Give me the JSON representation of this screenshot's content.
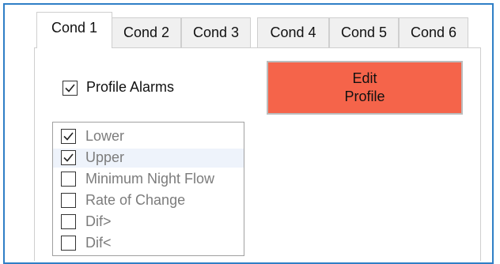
{
  "tabs": [
    {
      "label": "Cond 1",
      "active": true
    },
    {
      "label": "Cond 2",
      "active": false
    },
    {
      "label": "Cond 3",
      "active": false
    },
    {
      "label": "Cond 4",
      "active": false
    },
    {
      "label": "Cond 5",
      "active": false
    },
    {
      "label": "Cond 6",
      "active": false
    }
  ],
  "profile_alarms": {
    "label": "Profile Alarms",
    "checked": true
  },
  "edit_profile": {
    "line1": "Edit",
    "line2": "Profile",
    "color": "#f5644a"
  },
  "alarm_list": [
    {
      "label": "Lower",
      "checked": true
    },
    {
      "label": "Upper",
      "checked": true
    },
    {
      "label": "Minimum Night Flow",
      "checked": false
    },
    {
      "label": "Rate of Change",
      "checked": false
    },
    {
      "label": "Dif>",
      "checked": false
    },
    {
      "label": "Dif<",
      "checked": false
    }
  ],
  "colors": {
    "frame_border": "#2f7fc6",
    "button": "#f5644a",
    "list_text": "#7c7c7c"
  }
}
